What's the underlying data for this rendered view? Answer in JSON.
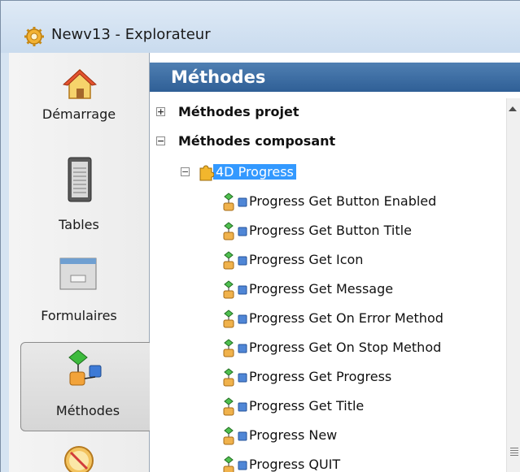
{
  "window": {
    "title": "Newv13 - Explorateur"
  },
  "sidebar": {
    "items": [
      {
        "label": "Démarrage",
        "icon": "house-icon"
      },
      {
        "label": "Tables",
        "icon": "table-icon"
      },
      {
        "label": "Formulaires",
        "icon": "form-icon"
      },
      {
        "label": "Méthodes",
        "icon": "methods-icon",
        "selected": true
      },
      {
        "label": "",
        "icon": "compass-icon"
      }
    ]
  },
  "main": {
    "header": "Méthodes",
    "tree": {
      "project": {
        "label": "Méthodes projet",
        "expander": "+"
      },
      "component": {
        "label": "Méthodes composant",
        "expander": "−"
      },
      "component_child": {
        "label": "4D Progress",
        "expander": "−"
      },
      "methods": [
        "Progress Get Button Enabled",
        "Progress Get Button Title",
        "Progress Get Icon",
        "Progress Get Message",
        "Progress Get On Error Method",
        "Progress Get On Stop Method",
        "Progress Get Progress",
        "Progress Get Title",
        "Progress New",
        "Progress QUIT"
      ]
    }
  },
  "colors": {
    "header_bg": "#3a6aa0",
    "selection_bg": "#3399ff",
    "sidebar_bg": "#f0f0f0"
  }
}
